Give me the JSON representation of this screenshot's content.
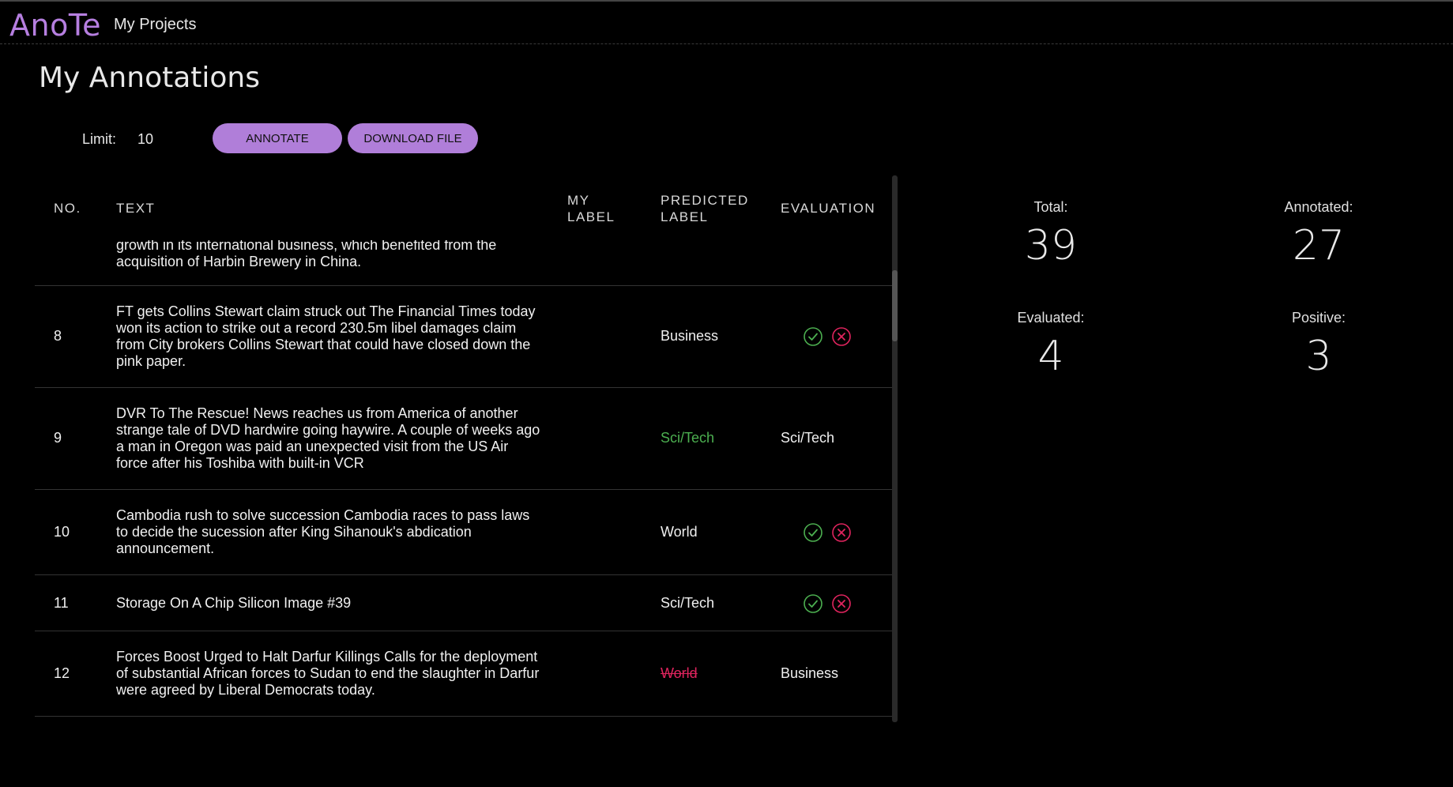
{
  "header": {
    "brand": "AnoTe",
    "nav_projects": "My Projects"
  },
  "page": {
    "title": "My Annotations"
  },
  "controls": {
    "limit_label": "Limit:",
    "limit_value": "10",
    "annotate_label": "ANNOTATE",
    "download_label": "DOWNLOAD FILE"
  },
  "table": {
    "headers": {
      "no": "NO.",
      "text": "TEXT",
      "my_label": "MY\nLABEL",
      "predicted_label": "PREDICTED\nLABEL",
      "evaluation": "EVALUATION"
    },
    "rows": [
      {
        "no": "",
        "text": "growth in its international business, which benefited from the acquisition of Harbin Brewery in China.",
        "my_label": "",
        "predicted_label": "",
        "prediction_status": "none",
        "evaluation": "",
        "evaluation_icons": false
      },
      {
        "no": "8",
        "text": "FT gets Collins Stewart claim struck out The Financial Times today won its action to strike out a record 230.5m libel damages claim from City brokers Collins Stewart that could have closed down the pink paper.",
        "my_label": "",
        "predicted_label": "Business",
        "prediction_status": "pending",
        "evaluation": "",
        "evaluation_icons": true
      },
      {
        "no": "9",
        "text": "DVR To The Rescue! News reaches us from America of another strange tale of DVD hardwire going haywire. A couple of weeks ago a man in Oregon was paid an unexpected visit from the US Air force after his Toshiba with built-in VCR",
        "my_label": "",
        "predicted_label": "Sci/Tech",
        "prediction_status": "correct",
        "evaluation": "Sci/Tech",
        "evaluation_icons": false
      },
      {
        "no": "10",
        "text": "Cambodia rush to solve succession Cambodia races to pass laws to decide the sucession after King Sihanouk's abdication announcement.",
        "my_label": "",
        "predicted_label": "World",
        "prediction_status": "pending",
        "evaluation": "",
        "evaluation_icons": true
      },
      {
        "no": "11",
        "text": "Storage On A Chip Silicon Image #39",
        "my_label": "",
        "predicted_label": "Sci/Tech",
        "prediction_status": "pending",
        "evaluation": "",
        "evaluation_icons": true
      },
      {
        "no": "12",
        "text": "Forces Boost Urged to Halt Darfur Killings Calls for the deployment of substantial African forces to Sudan to end the slaughter in Darfur were agreed by Liberal Democrats today.",
        "my_label": "",
        "predicted_label": "World",
        "prediction_status": "wrong",
        "evaluation": "Business",
        "evaluation_icons": false
      }
    ]
  },
  "stats": {
    "total_label": "Total:",
    "total_value": "39",
    "annotated_label": "Annotated:",
    "annotated_value": "27",
    "evaluated_label": "Evaluated:",
    "evaluated_value": "4",
    "positive_label": "Positive:",
    "positive_value": "3"
  },
  "colors": {
    "accent": "#b07ed9",
    "brand": "#b67fe0",
    "correct": "#4caf50",
    "wrong": "#e0245e"
  },
  "icons": {
    "accept": "check-circle-icon",
    "reject": "x-circle-icon"
  }
}
